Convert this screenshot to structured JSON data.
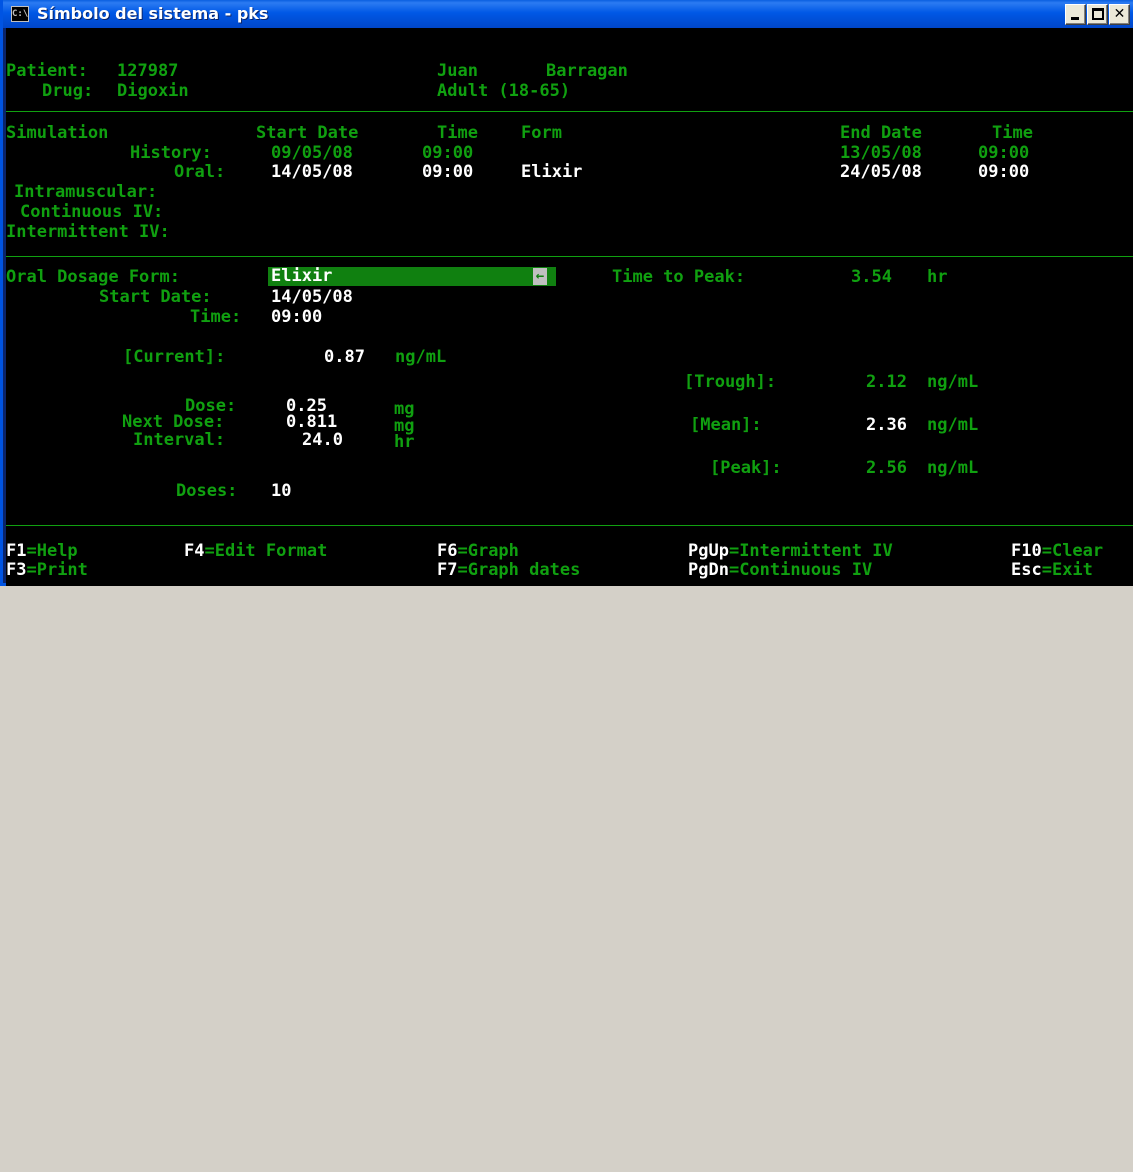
{
  "window": {
    "title": "Símbolo del sistema - pks",
    "icon_text": "C:\\"
  },
  "header": {
    "patient_label": "Patient:",
    "patient_id": "127987",
    "drug_label": "Drug:",
    "drug": "Digoxin",
    "first_name": "Juan",
    "last_name": "Barragan",
    "age_group": "Adult (18-65)"
  },
  "simulation": {
    "headers": {
      "simulation": "Simulation",
      "start_date": "Start Date",
      "time": "Time",
      "form": "Form",
      "end_date": "End Date",
      "end_time": "Time"
    },
    "rows": [
      {
        "label": "History:",
        "start_date": "09/05/08",
        "time": "09:00",
        "form": "",
        "end_date": "13/05/08",
        "end_time": "09:00"
      },
      {
        "label": "Oral:",
        "start_date": "14/05/08",
        "time": "09:00",
        "form": "Elixir",
        "end_date": "24/05/08",
        "end_time": "09:00"
      },
      {
        "label": "Intramuscular:"
      },
      {
        "label": "Continuous IV:"
      },
      {
        "label": "Intermittent IV:"
      }
    ]
  },
  "dosing": {
    "form_label": "Oral Dosage Form:",
    "form_value": "Elixir",
    "start_date_label": "Start Date:",
    "start_date": "14/05/08",
    "time_label": "Time:",
    "time": "09:00",
    "time_to_peak_label": "Time to Peak:",
    "time_to_peak": "3.54",
    "time_to_peak_unit": "hr",
    "current_label": "[Current]:",
    "current": "0.87",
    "current_unit": "ng/mL",
    "dose_label": "Dose:",
    "dose": "0.25",
    "dose_unit": "mg",
    "next_dose_label": "Next Dose:",
    "next_dose": "0.811",
    "next_dose_unit": "mg",
    "interval_label": "Interval:",
    "interval": "24.0",
    "interval_unit": "hr",
    "doses_label": "Doses:",
    "doses": "10",
    "trough_label": "[Trough]:",
    "trough": "2.12",
    "trough_unit": "ng/mL",
    "mean_label": "[Mean]:",
    "mean": "2.36",
    "mean_unit": "ng/mL",
    "peak_label": "[Peak]:",
    "peak": "2.56",
    "peak_unit": "ng/mL"
  },
  "keys": [
    {
      "key": "F1",
      "action": "=Help"
    },
    {
      "key": "F3",
      "action": "=Print"
    },
    {
      "key": "F4",
      "action": "=Edit Format"
    },
    {
      "key": "F6",
      "action": "=Graph"
    },
    {
      "key": "F7",
      "action": "=Graph dates"
    },
    {
      "key": "PgUp",
      "action": "=Intermittent IV"
    },
    {
      "key": "PgDn",
      "action": "=Continuous IV"
    },
    {
      "key": "F10",
      "action": "=Clear"
    },
    {
      "key": "Esc",
      "action": "=Exit"
    }
  ],
  "colors": {
    "label_green": "#10a010",
    "value_white": "#ffffff",
    "field_bg": "#108010",
    "title_blue": "#0058e6"
  }
}
